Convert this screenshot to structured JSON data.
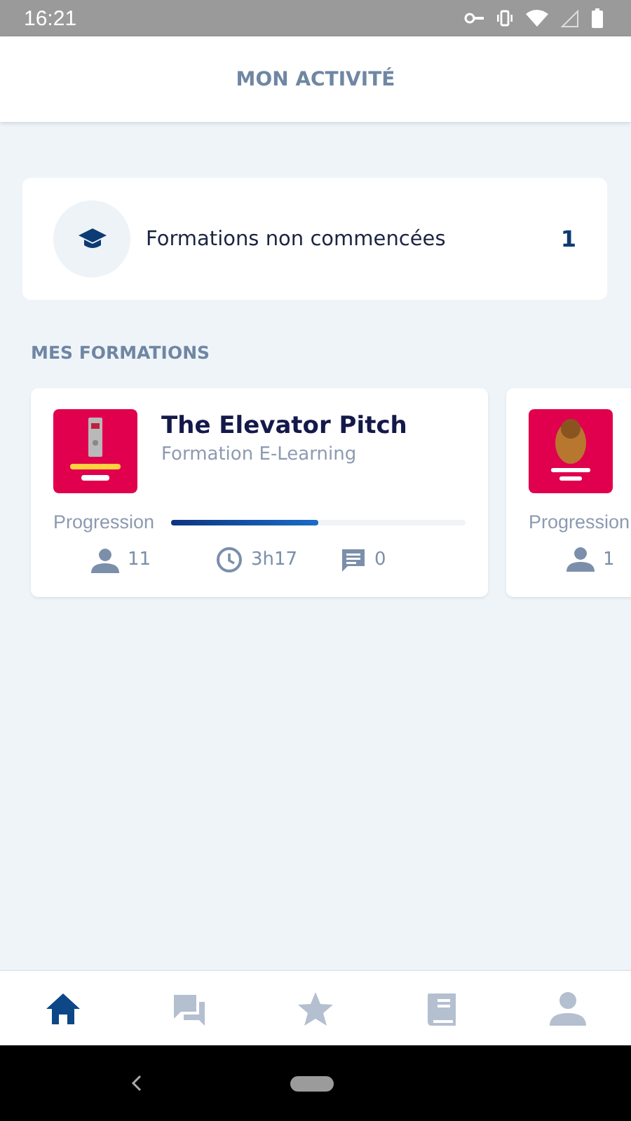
{
  "status_bar": {
    "time": "16:21"
  },
  "header": {
    "title": "MON ACTIVITÉ"
  },
  "summary": {
    "label": "Formations non commencées",
    "count": "1"
  },
  "section": {
    "title": "MES FORMATIONS"
  },
  "courses": [
    {
      "title": "The Elevator Pitch",
      "subtitle": "Formation E-Learning",
      "progress_label": "Progression",
      "level": 0.5,
      "learners": "11",
      "duration": "3h17",
      "comments": "0"
    },
    {
      "progress_label": "Progression",
      "learners": "1"
    }
  ],
  "nav": [
    {
      "kind": "home",
      "selected": true
    },
    {
      "kind": "chat",
      "selected": false
    },
    {
      "kind": "star",
      "selected": false
    },
    {
      "kind": "book",
      "selected": false
    },
    {
      "kind": "profile",
      "selected": false
    }
  ]
}
